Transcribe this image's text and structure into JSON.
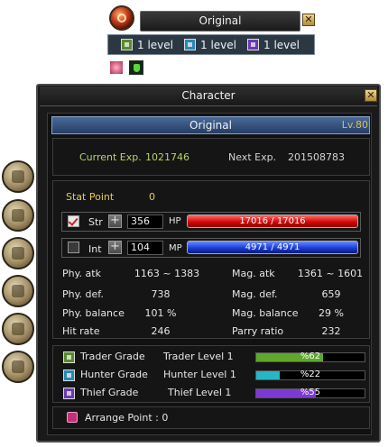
{
  "party": {
    "name": "Original",
    "close": "✕",
    "levels": [
      {
        "icon": "trader-icon",
        "text": "1 level"
      },
      {
        "icon": "hunter-icon",
        "text": "1 level"
      },
      {
        "icon": "thief-icon",
        "text": "1 level"
      }
    ]
  },
  "window": {
    "title": "Character",
    "close": "✕",
    "char_name": "Original",
    "level": "Lv.80"
  },
  "exp": {
    "current_label": "Current Exp.",
    "current_value": "1021746",
    "next_label": "Next Exp.",
    "next_value": "201508783"
  },
  "stat_point": {
    "label": "Stat Point",
    "value": "0"
  },
  "str": {
    "label": "Str",
    "value": "356",
    "checked": true
  },
  "int": {
    "label": "Int",
    "value": "104",
    "checked": false
  },
  "hp": {
    "label": "HP",
    "text": "17016 / 17016",
    "fraction": 1.0
  },
  "mp": {
    "label": "MP",
    "text": "4971 / 4971",
    "fraction": 1.0
  },
  "stats": [
    {
      "label": "Phy. atk",
      "value": "1163 ~ 1383",
      "label2": "Mag. atk",
      "value2": "1361 ~ 1601"
    },
    {
      "label": "Phy. def.",
      "value": "738",
      "label2": "Mag. def.",
      "value2": "659"
    },
    {
      "label": "Phy. balance",
      "value": "101 %",
      "label2": "Mag. balance",
      "value2": "29 %"
    },
    {
      "label": "Hit rate",
      "value": "246",
      "label2": "Parry ratio",
      "value2": "232"
    }
  ],
  "grades": [
    {
      "name": "Trader Grade",
      "level": "Trader Level 1",
      "pct_text": "%62",
      "fraction": 0.62,
      "color": "#5fa82a"
    },
    {
      "name": "Hunter Grade",
      "level": "Hunter Level 1",
      "pct_text": "%22",
      "fraction": 0.22,
      "color": "#27b6c8"
    },
    {
      "name": "Thief Grade",
      "level": "Thief Level 1",
      "pct_text": "%55",
      "fraction": 0.55,
      "color": "#7d3ad2"
    }
  ],
  "arrange": {
    "text": "Arrange Point : 0"
  },
  "colors": {
    "label_yellow": "#e4cc4c",
    "exp_green": "#b6d46a",
    "hp_red": "#d40808",
    "mp_blue": "#1a3ed8",
    "name_bar_blue": "#3a5a8a"
  }
}
